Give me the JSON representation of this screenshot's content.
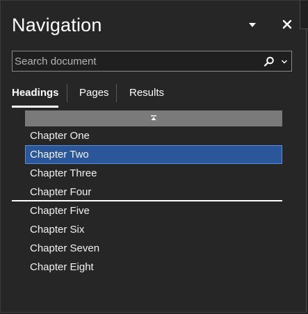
{
  "pane": {
    "title": "Navigation"
  },
  "search": {
    "placeholder": "Search document",
    "value": ""
  },
  "tabs": [
    {
      "label": "Headings",
      "active": true
    },
    {
      "label": "Pages",
      "active": false
    },
    {
      "label": "Results",
      "active": false
    }
  ],
  "headings": [
    {
      "label": "Chapter One",
      "selected": false
    },
    {
      "label": "Chapter Two",
      "selected": true
    },
    {
      "label": "Chapter Three",
      "selected": false
    },
    {
      "label": "Chapter Four",
      "selected": false
    },
    {
      "label": "Chapter Five",
      "selected": false
    },
    {
      "label": "Chapter Six",
      "selected": false
    },
    {
      "label": "Chapter Seven",
      "selected": false
    },
    {
      "label": "Chapter Eight",
      "selected": false
    }
  ],
  "icons": {
    "title_dropdown": "caret-down-icon",
    "close": "close-icon",
    "search": "search-icon",
    "search_options": "chevron-down-icon",
    "collapse": "collapse-up-icon"
  },
  "colors": {
    "background": "#262626",
    "selection": "#2b579a",
    "selection_border": "#5b8fd8",
    "collapse_bar": "#7a7a7a",
    "text": "#ffffff"
  }
}
